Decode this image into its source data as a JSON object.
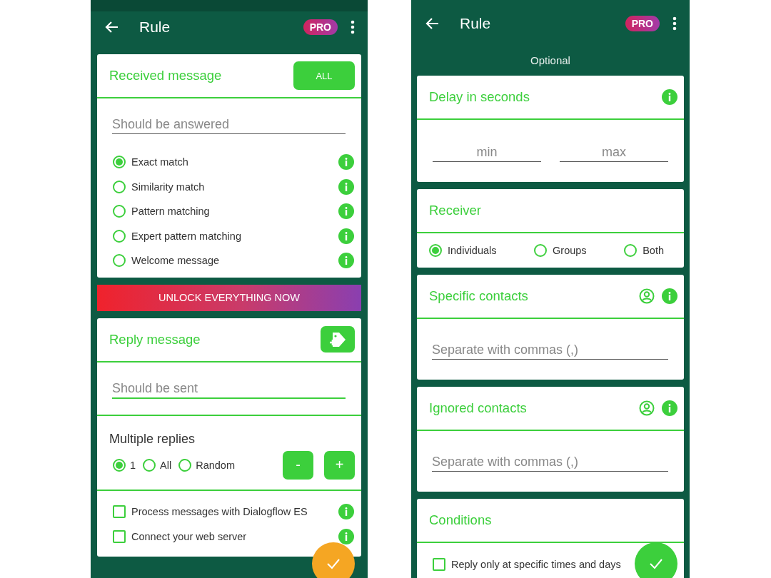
{
  "screens": [
    {
      "status_bar": true,
      "app_bar": {
        "title": "Rule",
        "badge": "PRO"
      },
      "sections": [
        {
          "kind": "card",
          "title": "Received message",
          "actions": [
            {
              "kind": "text_button",
              "label": "ALL"
            }
          ],
          "body": [
            {
              "kind": "field",
              "placeholder": "Should be answered",
              "focused": false
            },
            {
              "kind": "radio_list",
              "options": [
                {
                  "label": "Exact match",
                  "selected": true,
                  "info": true
                },
                {
                  "label": "Similarity match",
                  "selected": false,
                  "info": true
                },
                {
                  "label": "Pattern matching",
                  "selected": false,
                  "info": true
                },
                {
                  "label": "Expert pattern matching",
                  "selected": false,
                  "info": true
                },
                {
                  "label": "Welcome message",
                  "selected": false,
                  "info": true
                }
              ]
            }
          ]
        },
        {
          "kind": "banner",
          "label": "UNLOCK EVERYTHING NOW"
        },
        {
          "kind": "card",
          "title": "Reply message",
          "actions": [
            {
              "kind": "tag_button"
            }
          ],
          "body": [
            {
              "kind": "field",
              "placeholder": "Should be sent",
              "focused": true
            },
            {
              "kind": "divider"
            },
            {
              "kind": "subheading",
              "text": "Multiple replies"
            },
            {
              "kind": "choice_stepper",
              "options": [
                {
                  "label": "1",
                  "selected": true
                },
                {
                  "label": "All",
                  "selected": false
                },
                {
                  "label": "Random",
                  "selected": false
                }
              ],
              "buttons": [
                "-",
                "+"
              ]
            },
            {
              "kind": "divider"
            },
            {
              "kind": "checkbox_list",
              "items": [
                {
                  "label": "Process messages with Dialogflow ES",
                  "checked": false,
                  "info": true
                },
                {
                  "label": "Connect your web server",
                  "checked": false,
                  "info": true
                }
              ]
            }
          ]
        }
      ],
      "fab": {
        "color": "#f5a623"
      }
    },
    {
      "app_bar": {
        "title": "Rule",
        "badge": "PRO"
      },
      "subtitle": "Optional",
      "sections": [
        {
          "kind": "card",
          "title": "Delay in seconds",
          "actions": [
            {
              "kind": "info_icon"
            }
          ],
          "body": [
            {
              "kind": "field_pair",
              "fields": [
                {
                  "placeholder": "min"
                },
                {
                  "placeholder": "max"
                }
              ]
            }
          ]
        },
        {
          "kind": "card",
          "title": "Receiver",
          "body": [
            {
              "kind": "radio_row",
              "options": [
                {
                  "label": "Individuals",
                  "selected": true
                },
                {
                  "label": "Groups",
                  "selected": false
                },
                {
                  "label": "Both",
                  "selected": false
                }
              ]
            }
          ]
        },
        {
          "kind": "card",
          "title": "Specific contacts",
          "actions": [
            {
              "kind": "contact_icon"
            },
            {
              "kind": "info_icon"
            }
          ],
          "body": [
            {
              "kind": "field",
              "placeholder": "Separate with commas (,)",
              "focused": false
            }
          ]
        },
        {
          "kind": "card",
          "title": "Ignored contacts",
          "actions": [
            {
              "kind": "contact_icon"
            },
            {
              "kind": "info_icon"
            }
          ],
          "body": [
            {
              "kind": "field",
              "placeholder": "Separate with commas (,)",
              "focused": false
            }
          ]
        },
        {
          "kind": "card",
          "title": "Conditions",
          "body": [
            {
              "kind": "checkbox_list",
              "items": [
                {
                  "label": "Reply only at specific times and days",
                  "checked": false
                }
              ]
            }
          ]
        }
      ],
      "fab": {
        "color": "#3ccf3c"
      }
    }
  ]
}
